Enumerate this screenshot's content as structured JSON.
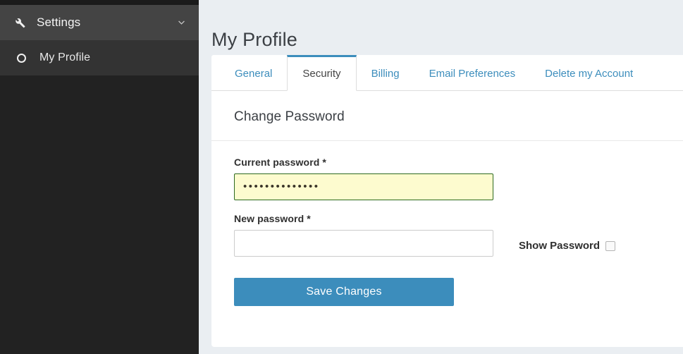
{
  "sidebar": {
    "group": {
      "label": "Settings",
      "icon": "wrench-icon",
      "chevron": "chevron-down-icon"
    },
    "items": [
      {
        "label": "My Profile",
        "icon": "circle-icon",
        "active": true
      }
    ]
  },
  "header": {
    "title": "My Profile"
  },
  "tabs": [
    {
      "label": "General",
      "active": false
    },
    {
      "label": "Security",
      "active": true
    },
    {
      "label": "Billing",
      "active": false
    },
    {
      "label": "Email Preferences",
      "active": false
    },
    {
      "label": "Delete my Account",
      "active": false
    }
  ],
  "form": {
    "section_title": "Change Password",
    "current_password": {
      "label": "Current password *",
      "value": "••••••••••••••",
      "placeholder": ""
    },
    "new_password": {
      "label": "New password *",
      "value": "",
      "placeholder": ""
    },
    "show_password": {
      "label": "Show Password",
      "checked": false
    },
    "submit_label": "Save Changes"
  },
  "colors": {
    "accent": "#3c8dbc",
    "sidebar_bg": "#222222",
    "sidebar_group_bg": "#444444",
    "sidebar_item_bg": "#333333",
    "page_bg": "#eaeef2",
    "autofill_bg": "#fdfbcf",
    "autofill_border": "#2d6a1e"
  }
}
